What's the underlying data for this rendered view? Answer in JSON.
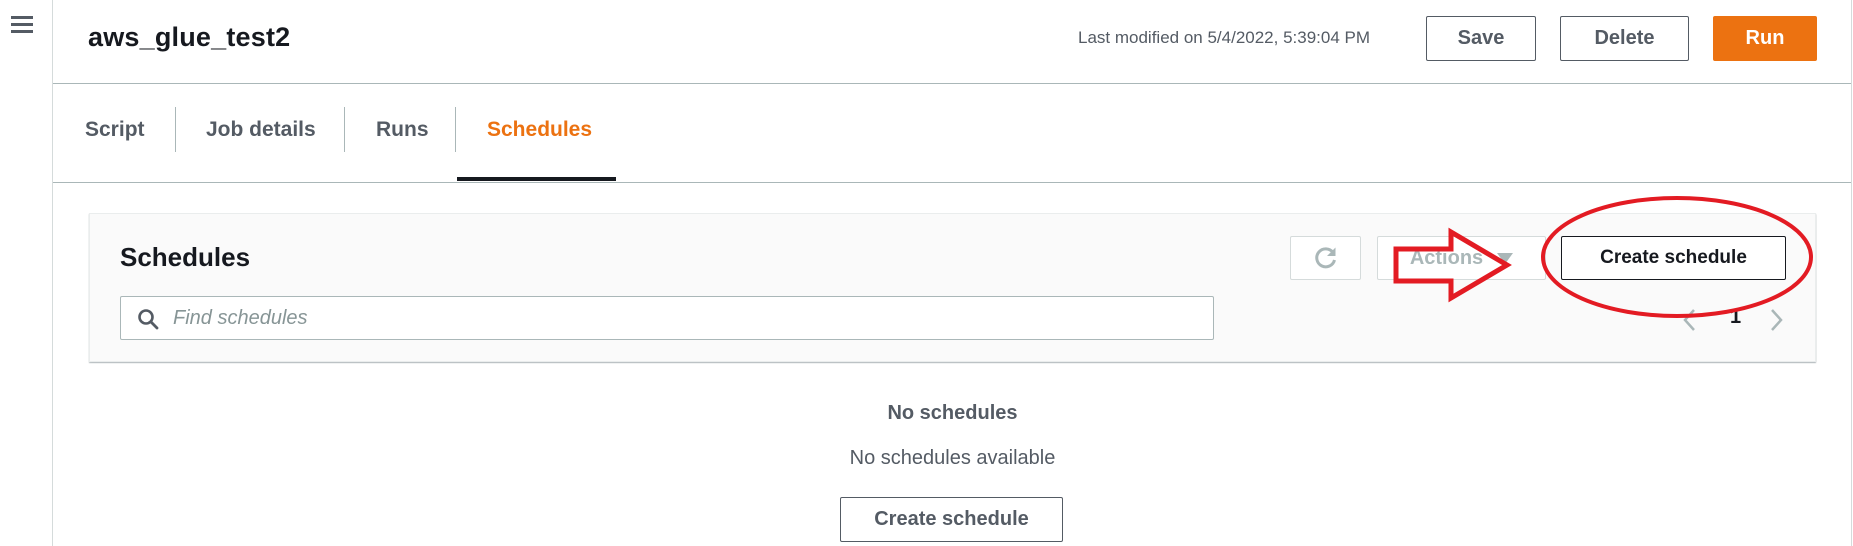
{
  "nav": {
    "menu_icon": "hamburger-menu-icon"
  },
  "header": {
    "title": "aws_glue_test2",
    "last_modified": "Last modified on 5/4/2022, 5:39:04 PM",
    "save_label": "Save",
    "delete_label": "Delete",
    "run_label": "Run"
  },
  "tabs": [
    {
      "label": "Script",
      "active": false
    },
    {
      "label": "Job details",
      "active": false
    },
    {
      "label": "Runs",
      "active": false
    },
    {
      "label": "Schedules",
      "active": true
    }
  ],
  "schedules_panel": {
    "title": "Schedules",
    "search_placeholder": "Find schedules",
    "search_value": "",
    "refresh_icon": "refresh-icon",
    "actions_label": "Actions",
    "actions_disabled": true,
    "create_label": "Create schedule",
    "pagination": {
      "current_page": "1"
    }
  },
  "empty_state": {
    "title": "No schedules",
    "subtitle": "No schedules available",
    "create_label": "Create schedule"
  },
  "annotations": {
    "arrow": "red-arrow-pointing-right",
    "ellipse": "red-circle-around-create-schedule",
    "color": "#e31b23"
  },
  "colors": {
    "accent": "#ec7211",
    "text_primary": "#16191f",
    "text_secondary": "#545b64",
    "disabled": "#aab7b8"
  }
}
